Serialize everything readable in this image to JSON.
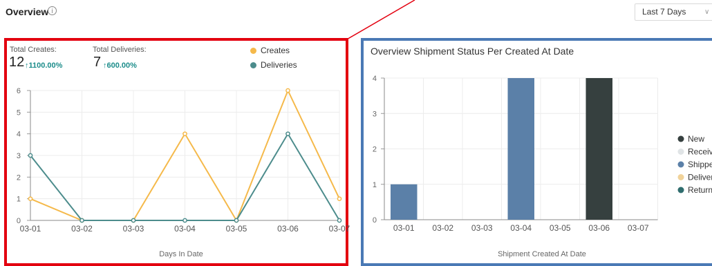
{
  "header": {
    "title": "Overview",
    "info_icon": "info-circle-icon",
    "range_select": {
      "value": "Last 7 Days",
      "icon": "chevron-down-icon"
    }
  },
  "stats": {
    "creates_label": "Total Creates:",
    "creates_value": "12",
    "creates_change": "↑1100.00%",
    "deliveries_label": "Total Deliveries:",
    "deliveries_value": "7",
    "deliveries_change": "↑600.00%"
  },
  "colors": {
    "creates": "#f5b94a",
    "deliveries": "#4c8c8c",
    "annotation_left": "#e3000f",
    "annotation_right": "#4a79b5"
  },
  "chart_data": [
    {
      "type": "line",
      "title": "",
      "x": [
        "03-01",
        "03-02",
        "03-03",
        "03-04",
        "03-05",
        "03-06",
        "03-07"
      ],
      "series": [
        {
          "name": "Creates",
          "values": [
            1,
            0,
            0,
            4,
            0,
            6,
            1
          ]
        },
        {
          "name": "Deliveries",
          "values": [
            3,
            0,
            0,
            0,
            0,
            4,
            0
          ]
        }
      ],
      "xlabel": "Days In Date",
      "ylabel": "",
      "ylim": [
        0,
        6
      ],
      "yticks": [
        "0",
        "1",
        "2",
        "3",
        "4",
        "5",
        "6"
      ],
      "grid": true,
      "legend": "top-right"
    },
    {
      "type": "bar",
      "title": "Overview Shipment Status Per Created At Date",
      "categories": [
        "03-01",
        "03-02",
        "03-03",
        "03-04",
        "03-05",
        "03-06",
        "03-07"
      ],
      "series": [
        {
          "name": "New",
          "color": "#36403f",
          "values": [
            0,
            0,
            0,
            0,
            0,
            4,
            0
          ]
        },
        {
          "name": "Receive",
          "color": "#e0e4e6",
          "values": [
            0,
            0,
            0,
            0,
            0,
            0,
            0
          ]
        },
        {
          "name": "Shippe",
          "color": "#5b80a8",
          "values": [
            1,
            0,
            0,
            4,
            0,
            0,
            0
          ]
        },
        {
          "name": "Deliver",
          "color": "#f1d39a",
          "values": [
            0,
            0,
            0,
            0,
            0,
            0,
            0
          ]
        },
        {
          "name": "Returne",
          "color": "#2f6d6e",
          "values": [
            0,
            0,
            0,
            0,
            0,
            0,
            0
          ]
        }
      ],
      "xlabel": "Shipment Created At Date",
      "ylabel": "",
      "ylim": [
        0,
        4
      ],
      "yticks": [
        "0",
        "1",
        "2",
        "3",
        "4"
      ],
      "grid": true,
      "legend": "right"
    }
  ]
}
